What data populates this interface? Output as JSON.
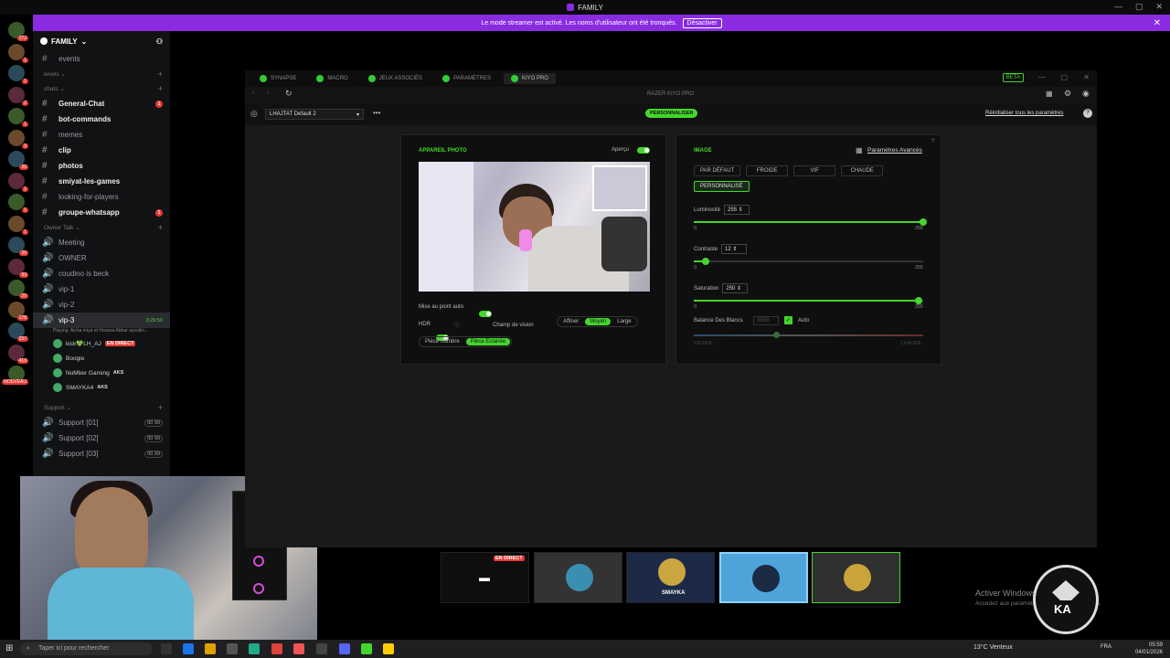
{
  "titlebar": {
    "title": "FAMILY"
  },
  "banner": {
    "text": "Le mode streamer est activé. Les noms d'utilisateur ont été tronqués.",
    "button": "Désactiver"
  },
  "server_badges": [
    "172",
    "1",
    "1",
    "2",
    "1",
    "3",
    "25",
    "1",
    "1",
    "1",
    "20",
    "93",
    "25",
    "178",
    "237",
    "410",
    "NOUVEAU"
  ],
  "channels": {
    "server_name": "FAMILY",
    "items": [
      {
        "kind": "ch",
        "name": "events",
        "deco": "🔊"
      },
      {
        "kind": "cat",
        "name": "levels"
      },
      {
        "kind": "cat",
        "name": "chats"
      },
      {
        "kind": "ch",
        "name": "General-Chat",
        "bold": true,
        "unread": "1"
      },
      {
        "kind": "ch",
        "name": "bot-commands",
        "bold": true
      },
      {
        "kind": "ch",
        "name": "memes"
      },
      {
        "kind": "ch",
        "name": "clip",
        "bold": true
      },
      {
        "kind": "ch",
        "name": "photos",
        "bold": true
      },
      {
        "kind": "ch",
        "name": "smiyat-les-games",
        "bold": true
      },
      {
        "kind": "ch",
        "name": "looking-for-players"
      },
      {
        "kind": "ch",
        "name": "groupe-whatsapp",
        "bold": true,
        "unread": "1"
      },
      {
        "kind": "cat",
        "name": "Owner Talk"
      },
      {
        "kind": "vc",
        "name": "Meeting"
      },
      {
        "kind": "vc",
        "name": "OWNER"
      },
      {
        "kind": "vc",
        "name": "coudino is beck"
      },
      {
        "kind": "vc",
        "name": "vip-1"
      },
      {
        "kind": "vc",
        "name": "vip-2"
      },
      {
        "kind": "vc",
        "name": "vip-3",
        "active": true,
        "dur": "3:29:59"
      }
    ],
    "activity": "Playing: Aicha miya et Houssa Abbar ayouliin...",
    "voice_users": [
      {
        "name": "kick💚LH_AJ",
        "live": "EN DIRECT"
      },
      {
        "name": "Boogie"
      },
      {
        "name": "NuMber Gaming",
        "tag": "AKS"
      },
      {
        "name": "SMAYKA4",
        "tag": "AKS"
      }
    ],
    "support_cat": "Support",
    "support": [
      {
        "name": "Support [01]",
        "count": "00 99"
      },
      {
        "name": "Support [02]",
        "count": "00 99"
      },
      {
        "name": "Support [03]",
        "count": "00 99"
      }
    ]
  },
  "razer": {
    "tabs": [
      "SYNAPSE",
      "MACRO",
      "JEUX ASSOCIÉS",
      "PARAMÈTRES",
      "KIYO PRO"
    ],
    "beta": "BETA",
    "window_title": "RAZER KIYO PRO",
    "profile": "LHAJTAT Default 2",
    "personalize": "PERSONNALISER",
    "reset": "Réinitialiser tous les paramètres",
    "camera": {
      "title": "APPAREIL PHOTO",
      "apercu": "Aperçu",
      "autofocus": "Mise au point auto",
      "hdr": "HDR",
      "fov_label": "Champ de vision",
      "fov": [
        "Affiner",
        "Moyen",
        "Large"
      ],
      "fov_selected": "Moyen",
      "rooms": [
        "Pièce Sombre",
        "Pièce Éclairée"
      ],
      "room_selected": "Pièce Éclairée"
    },
    "image": {
      "title": "IMAGE",
      "advanced": "Paramètres Avancés",
      "presets": [
        "PAR DÉFAUT",
        "FROIDE",
        "VIF",
        "CHAUDE"
      ],
      "custom": "PERSONNALISÉ",
      "sliders": [
        {
          "label": "Luminosité",
          "value": "255",
          "min": "0",
          "max": "255",
          "frac": 1.0
        },
        {
          "label": "Contraste",
          "value": "12",
          "min": "0",
          "max": "255",
          "frac": 0.05
        },
        {
          "label": "Saturation",
          "value": "250",
          "min": "0",
          "max": "255",
          "frac": 0.98
        }
      ],
      "wb_label": "Balance Des Blancs",
      "wb_value": "3500",
      "wb_auto": "Auto",
      "wb_min": "FROIDE",
      "wb_max": "CHAUDE"
    }
  },
  "streams": {
    "live": "EN DIRECT",
    "names": [
      "SMAYKA"
    ]
  },
  "watermark": {
    "title": "Activer Windows",
    "sub": "Accédez aux paramètres pour activer Windows."
  },
  "taskbar": {
    "search": "Taper ici pour rechercher",
    "weather": "13°C Venteux",
    "lang": "FRA",
    "time": "05:59",
    "date": "04/01/2026"
  },
  "colors": {
    "accent": "#44d62c",
    "banner": "#8a2be2",
    "live": "#e53935"
  }
}
